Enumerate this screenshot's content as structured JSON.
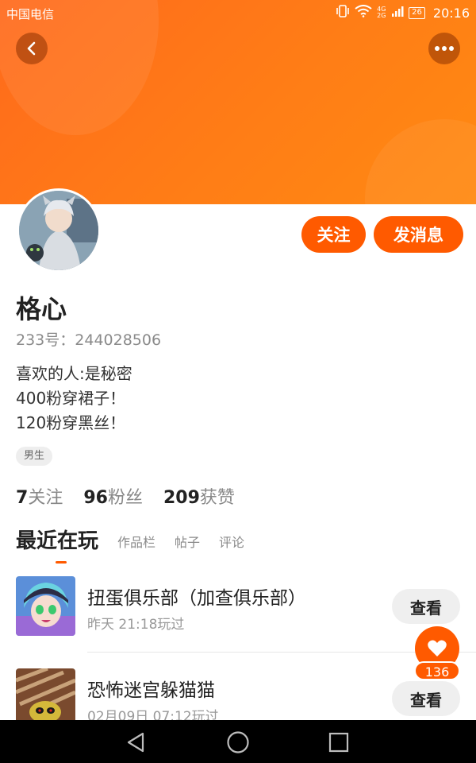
{
  "status_bar": {
    "carrier": "中国电信",
    "network": "4G 2G",
    "battery": "26",
    "time": "20:16",
    "icons": [
      "vibrate-icon",
      "wifi-icon",
      "signal-icon",
      "battery-icon"
    ]
  },
  "header": {
    "back_icon": "chevron-left-icon",
    "more_icon": "more-dots-icon"
  },
  "profile": {
    "avatar": "avatar-image",
    "username": "格心",
    "uid_label": "233号：",
    "uid": "244028506",
    "bio": [
      "喜欢的人:是秘密",
      "400粉穿裙子！",
      "120粉穿黑丝！"
    ],
    "gender_tag": "男生",
    "follow_button": "关注",
    "message_button": "发消息"
  },
  "stats": [
    {
      "num": "7",
      "label": "关注"
    },
    {
      "num": "96",
      "label": "粉丝"
    },
    {
      "num": "209",
      "label": "获赞"
    }
  ],
  "tabs": {
    "active": "最近在玩",
    "items": [
      "作品栏",
      "帖子",
      "评论"
    ]
  },
  "games": [
    {
      "name": "扭蛋俱乐部（加查俱乐部）",
      "meta": "昨天 21:18玩过",
      "button": "查看"
    },
    {
      "name": "恐怖迷宫躲猫猫",
      "meta": "02月09日 07:12玩过",
      "button": "查看"
    }
  ],
  "like_fab": {
    "icon": "heart-icon",
    "count": "136"
  },
  "nav_bar": {
    "icons": [
      "nav-back-icon",
      "nav-home-icon",
      "nav-recent-icon"
    ]
  },
  "colors": {
    "accent": "#ff5a00",
    "banner": "#ff7a18"
  }
}
